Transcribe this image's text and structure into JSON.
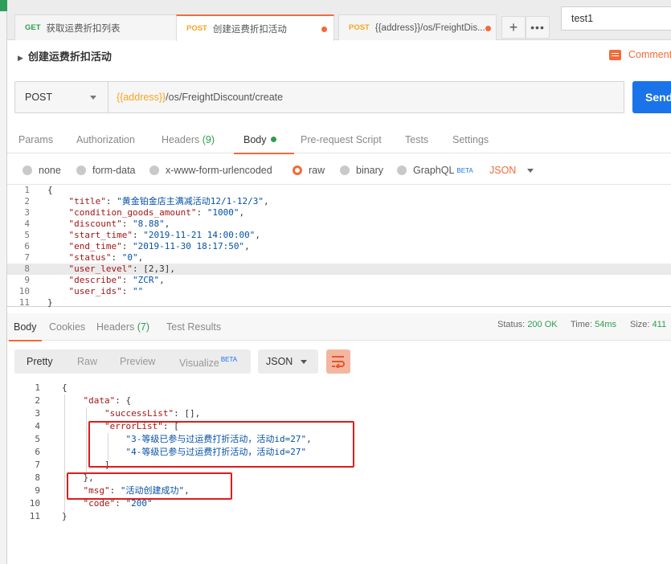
{
  "tabs": [
    {
      "method": "GET",
      "label": "获取运费折扣列表"
    },
    {
      "method": "POST",
      "label": "创建运费折扣活动"
    },
    {
      "method": "POST",
      "label": "{{address}}/os/FreightDis..."
    }
  ],
  "tab_actions": {
    "add_icon": "plus-icon",
    "more_icon": "more-icon"
  },
  "environment": {
    "name": "test1"
  },
  "request": {
    "title": "创建运费折扣活动",
    "comments_label": "Comments",
    "method": "POST",
    "url_var": "{{address}}",
    "url_path": "/os/FreightDiscount/create",
    "send_label": "Send"
  },
  "request_tabs": [
    {
      "label": "Params"
    },
    {
      "label": "Authorization"
    },
    {
      "label": "Headers",
      "count": "(9)"
    },
    {
      "label": "Body"
    },
    {
      "label": "Pre-request Script"
    },
    {
      "label": "Tests"
    },
    {
      "label": "Settings"
    }
  ],
  "body_options": [
    {
      "label": "none"
    },
    {
      "label": "form-data"
    },
    {
      "label": "x-www-form-urlencoded"
    },
    {
      "label": "raw"
    },
    {
      "label": "binary"
    },
    {
      "label": "GraphQL",
      "badge": "BETA"
    }
  ],
  "body_format": "JSON",
  "request_body_lines": [
    {
      "n": "1",
      "text": "{"
    },
    {
      "n": "2",
      "key": "\"title\"",
      "val": "\"黄金铂金店主满减活动12/1-12/3\"",
      "tail": ","
    },
    {
      "n": "3",
      "key": "\"condition_goods_amount\"",
      "val": "\"1000\"",
      "tail": ","
    },
    {
      "n": "4",
      "key": "\"discount\"",
      "val": "\"8.88\"",
      "tail": ","
    },
    {
      "n": "5",
      "key": "\"start_time\"",
      "val": "\"2019-11-21 14:00:00\"",
      "tail": ","
    },
    {
      "n": "6",
      "key": "\"end_time\"",
      "val": "\"2019-11-30 18:17:50\"",
      "tail": ","
    },
    {
      "n": "7",
      "key": "\"status\"",
      "val": "\"0\"",
      "tail": ","
    },
    {
      "n": "8",
      "key": "\"user_level\"",
      "val": "[2,3]",
      "tail": ","
    },
    {
      "n": "9",
      "key": "\"describe\"",
      "val": "\"ZCR\"",
      "tail": ","
    },
    {
      "n": "10",
      "key": "\"user_ids\"",
      "val": "\"\"",
      "tail": ""
    },
    {
      "n": "11",
      "text": "}"
    }
  ],
  "response_tabs": [
    {
      "label": "Body"
    },
    {
      "label": "Cookies"
    },
    {
      "label": "Headers",
      "count": "(7)"
    },
    {
      "label": "Test Results"
    }
  ],
  "response_status": {
    "status_label": "Status:",
    "status_value": "200 OK",
    "time_label": "Time:",
    "time_value": "54ms",
    "size_label": "Size:",
    "size_value": "411"
  },
  "response_views": [
    {
      "label": "Pretty"
    },
    {
      "label": "Raw"
    },
    {
      "label": "Preview"
    },
    {
      "label": "Visualize",
      "badge": "BETA"
    }
  ],
  "response_format": "JSON",
  "wrap_icon": "wrap-lines-icon",
  "response_lines": [
    {
      "n": "1",
      "text": "{"
    },
    {
      "n": "2",
      "key": "\"data\"",
      "val": "{",
      "tail": ""
    },
    {
      "n": "3",
      "key": "\"successList\"",
      "val": "[]",
      "tail": ","
    },
    {
      "n": "4",
      "key": "\"errorList\"",
      "val": "[",
      "tail": ""
    },
    {
      "n": "5",
      "str": "\"3-等级已参与过运费打折活动，活动id=27\"",
      "tail": ","
    },
    {
      "n": "6",
      "str": "\"4-等级已参与过运费打折活动，活动id=27\"",
      "tail": ""
    },
    {
      "n": "7",
      "text": "]"
    },
    {
      "n": "8",
      "text": "},"
    },
    {
      "n": "9",
      "key": "\"msg\"",
      "val": "\"活动创建成功\"",
      "tail": ","
    },
    {
      "n": "10",
      "key": "\"code\"",
      "val": "\"200\"",
      "tail": ""
    },
    {
      "n": "11",
      "text": "}"
    }
  ],
  "colors": {
    "accent": "#f26b3a",
    "send": "#1a73e8",
    "ok": "#2e9d4f",
    "highlight_box": "#e21b1b"
  }
}
